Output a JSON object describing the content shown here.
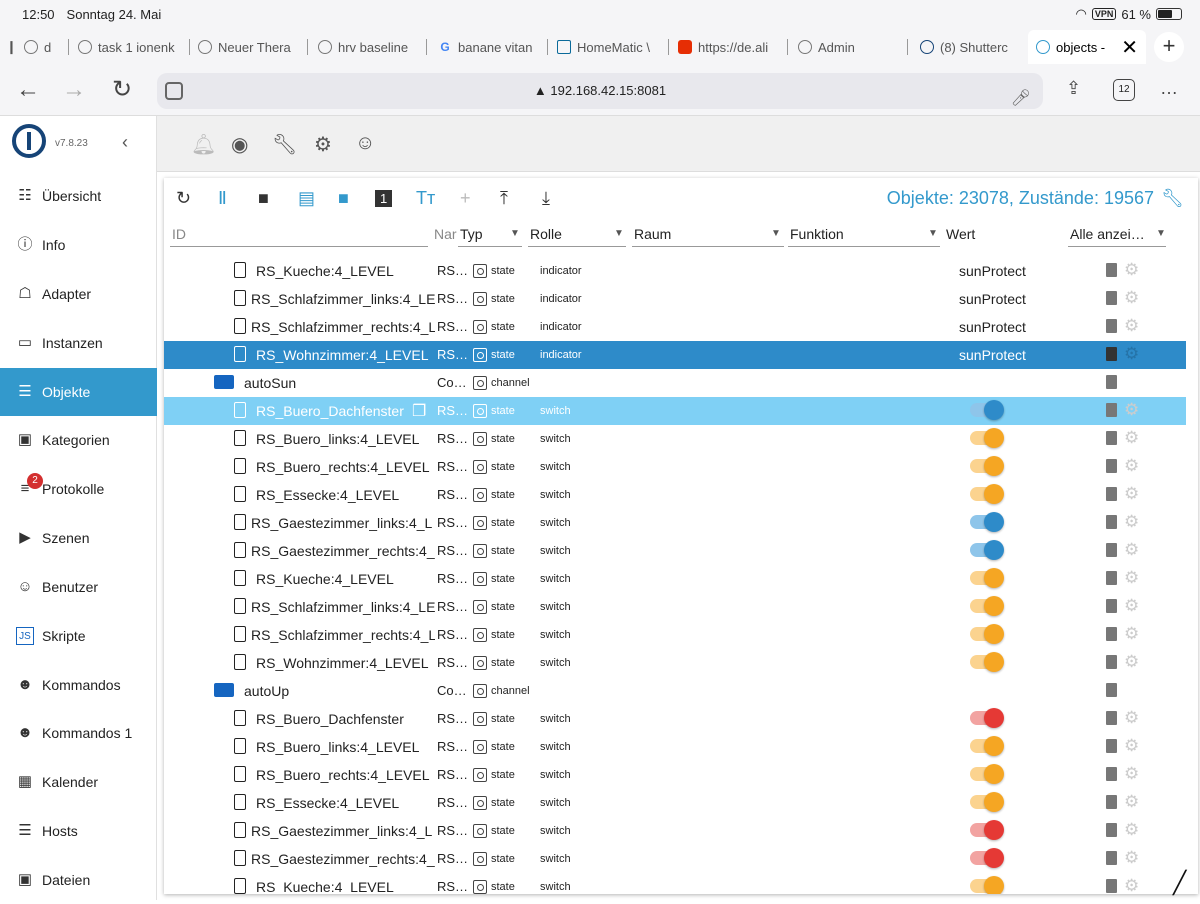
{
  "status_bar": {
    "time": "12:50",
    "date": "Sonntag 24. Mai",
    "vpn": "VPN",
    "battery": "61 %"
  },
  "browser_tabs": [
    {
      "label": "d"
    },
    {
      "label": "task 1 ionenk"
    },
    {
      "label": "Neuer Thera"
    },
    {
      "label": "hrv baseline"
    },
    {
      "label": "banane vitan"
    },
    {
      "label": "HomeMatic \\"
    },
    {
      "label": "https://de.ali"
    },
    {
      "label": "Admin"
    },
    {
      "label": "(8) Shutterc"
    },
    {
      "label": "objects -",
      "active": true
    }
  ],
  "address_bar": {
    "url": "192.168.42.15:8081",
    "tab_count": "12"
  },
  "sidebar": {
    "version": "v7.8.23",
    "items": [
      {
        "label": "Übersicht",
        "icon": "grid-icon"
      },
      {
        "label": "Info",
        "icon": "info-icon"
      },
      {
        "label": "Adapter",
        "icon": "store-icon"
      },
      {
        "label": "Instanzen",
        "icon": "instances-icon"
      },
      {
        "label": "Objekte",
        "icon": "list-icon",
        "selected": true
      },
      {
        "label": "Kategorien",
        "icon": "categories-icon"
      },
      {
        "label": "Protokolle",
        "icon": "log-icon",
        "badge": "2"
      },
      {
        "label": "Szenen",
        "icon": "scene-icon"
      },
      {
        "label": "Benutzer",
        "icon": "user-icon"
      },
      {
        "label": "Skripte",
        "icon": "js-icon"
      },
      {
        "label": "Kommandos",
        "icon": "person-icon"
      },
      {
        "label": "Kommandos 1",
        "icon": "person-icon"
      },
      {
        "label": "Kalender",
        "icon": "calendar-icon"
      },
      {
        "label": "Hosts",
        "icon": "hosts-icon"
      },
      {
        "label": "Dateien",
        "icon": "files-icon"
      }
    ]
  },
  "objects": {
    "counts": "Objekte: 23078, Zustände: 19567",
    "headers": {
      "id": "ID",
      "name": "Nar",
      "type": "Typ",
      "role": "Rolle",
      "room": "Raum",
      "function": "Funktion",
      "value": "Wert",
      "filter": "Alle anzei…"
    },
    "rows": [
      {
        "name": "RS_Kueche:4_LEVEL",
        "nr": "RS…",
        "type": "state",
        "role": "indicator",
        "value": "sunProtect",
        "kind": "locked"
      },
      {
        "name": "RS_Schlafzimmer_links:4_LE",
        "nr": "RS…",
        "type": "state",
        "role": "indicator",
        "value": "sunProtect",
        "kind": "locked"
      },
      {
        "name": "RS_Schlafzimmer_rechts:4_L",
        "nr": "RS…",
        "type": "state",
        "role": "indicator",
        "value": "sunProtect",
        "kind": "locked"
      },
      {
        "name": "RS_Wohnzimmer:4_LEVEL",
        "nr": "RS…",
        "type": "state",
        "role": "indicator",
        "value": "sunProtect",
        "kind": "locked",
        "sel": "s1"
      },
      {
        "name": "autoSun",
        "nr": "Co…",
        "type": "channel",
        "role": "",
        "kind": "folder"
      },
      {
        "name": "RS_Buero_Dachfenster",
        "nr": "RS…",
        "type": "state",
        "role": "switch",
        "toggle": "#2e8bc9",
        "kind": "file",
        "sel": "s2"
      },
      {
        "name": "RS_Buero_links:4_LEVEL",
        "nr": "RS…",
        "type": "state",
        "role": "switch",
        "toggle": "#f5a623",
        "kind": "file"
      },
      {
        "name": "RS_Buero_rechts:4_LEVEL",
        "nr": "RS…",
        "type": "state",
        "role": "switch",
        "toggle": "#f5a623",
        "kind": "file"
      },
      {
        "name": "RS_Essecke:4_LEVEL",
        "nr": "RS…",
        "type": "state",
        "role": "switch",
        "toggle": "#f5a623",
        "kind": "file"
      },
      {
        "name": "RS_Gaestezimmer_links:4_L",
        "nr": "RS…",
        "type": "state",
        "role": "switch",
        "toggle": "#2e8bc9",
        "kind": "file"
      },
      {
        "name": "RS_Gaestezimmer_rechts:4_",
        "nr": "RS…",
        "type": "state",
        "role": "switch",
        "toggle": "#2e8bc9",
        "kind": "file"
      },
      {
        "name": "RS_Kueche:4_LEVEL",
        "nr": "RS…",
        "type": "state",
        "role": "switch",
        "toggle": "#f5a623",
        "kind": "file"
      },
      {
        "name": "RS_Schlafzimmer_links:4_LE",
        "nr": "RS…",
        "type": "state",
        "role": "switch",
        "toggle": "#f5a623",
        "kind": "file"
      },
      {
        "name": "RS_Schlafzimmer_rechts:4_L",
        "nr": "RS…",
        "type": "state",
        "role": "switch",
        "toggle": "#f5a623",
        "kind": "file"
      },
      {
        "name": "RS_Wohnzimmer:4_LEVEL",
        "nr": "RS…",
        "type": "state",
        "role": "switch",
        "toggle": "#f5a623",
        "kind": "file"
      },
      {
        "name": "autoUp",
        "nr": "Co…",
        "type": "channel",
        "role": "",
        "kind": "folder"
      },
      {
        "name": "RS_Buero_Dachfenster",
        "nr": "RS…",
        "type": "state",
        "role": "switch",
        "toggle": "#e53935",
        "kind": "file"
      },
      {
        "name": "RS_Buero_links:4_LEVEL",
        "nr": "RS…",
        "type": "state",
        "role": "switch",
        "toggle": "#f5a623",
        "kind": "file"
      },
      {
        "name": "RS_Buero_rechts:4_LEVEL",
        "nr": "RS…",
        "type": "state",
        "role": "switch",
        "toggle": "#f5a623",
        "kind": "file"
      },
      {
        "name": "RS_Essecke:4_LEVEL",
        "nr": "RS…",
        "type": "state",
        "role": "switch",
        "toggle": "#f5a623",
        "kind": "file"
      },
      {
        "name": "RS_Gaestezimmer_links:4_L",
        "nr": "RS…",
        "type": "state",
        "role": "switch",
        "toggle": "#e53935",
        "kind": "file"
      },
      {
        "name": "RS_Gaestezimmer_rechts:4_",
        "nr": "RS…",
        "type": "state",
        "role": "switch",
        "toggle": "#e53935",
        "kind": "file"
      },
      {
        "name": "RS_Kueche:4_LEVEL",
        "nr": "RS…",
        "type": "state",
        "role": "switch",
        "toggle": "#f5a623",
        "kind": "file"
      }
    ]
  },
  "colors": {
    "accent": "#3399cc",
    "selected_row": "#2e8bc9",
    "hover_row": "#7fd0f5"
  }
}
